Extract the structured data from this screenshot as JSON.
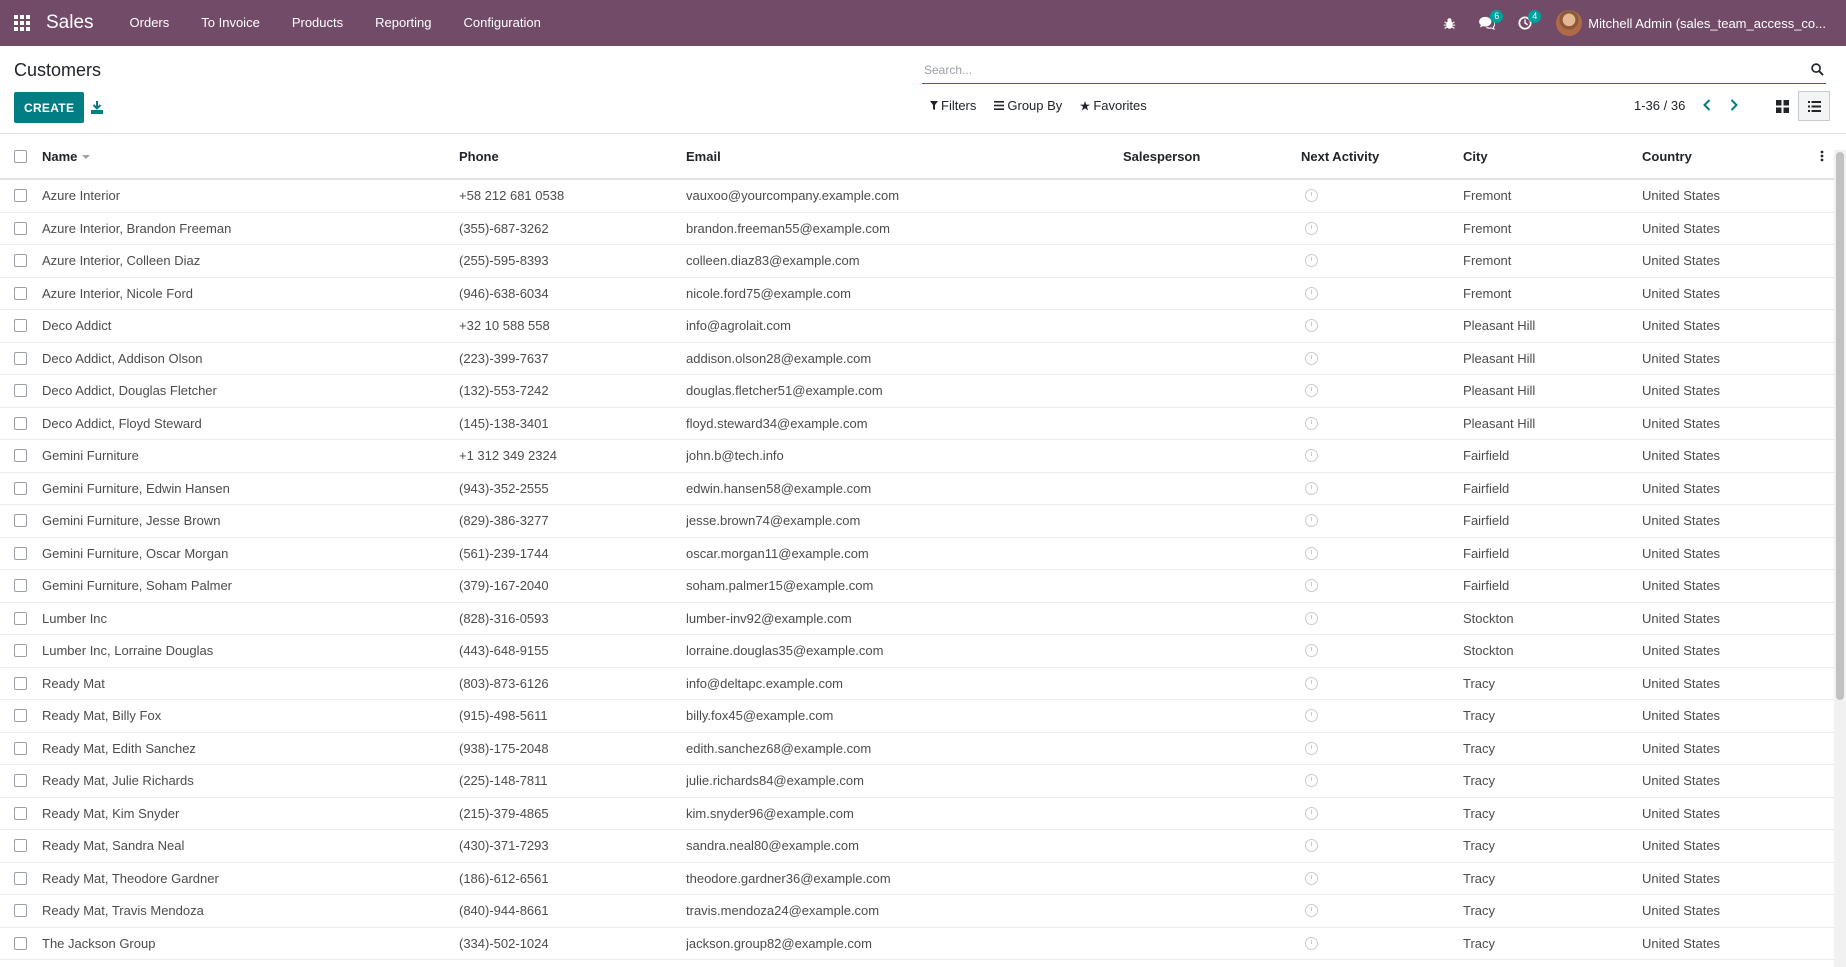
{
  "navbar": {
    "app_name": "Sales",
    "menu": [
      "Orders",
      "To Invoice",
      "Products",
      "Reporting",
      "Configuration"
    ],
    "messages_badge": "6",
    "activities_badge": "4",
    "user_name": "Mitchell Admin (sales_team_access_co..."
  },
  "control": {
    "breadcrumb": "Customers",
    "create_label": "CREATE",
    "search_placeholder": "Search...",
    "filters_label": "Filters",
    "groupby_label": "Group By",
    "favorites_label": "Favorites",
    "pager": "1-36 / 36"
  },
  "table": {
    "headers": {
      "name": "Name",
      "phone": "Phone",
      "email": "Email",
      "salesperson": "Salesperson",
      "next_activity": "Next Activity",
      "city": "City",
      "country": "Country"
    },
    "rows": [
      {
        "name": "Azure Interior",
        "phone": "+58 212 681 0538",
        "email": "vauxoo@yourcompany.example.com",
        "salesperson": "",
        "city": "Fremont",
        "country": "United States"
      },
      {
        "name": "Azure Interior, Brandon Freeman",
        "phone": "(355)-687-3262",
        "email": "brandon.freeman55@example.com",
        "salesperson": "",
        "city": "Fremont",
        "country": "United States"
      },
      {
        "name": "Azure Interior, Colleen Diaz",
        "phone": "(255)-595-8393",
        "email": "colleen.diaz83@example.com",
        "salesperson": "",
        "city": "Fremont",
        "country": "United States"
      },
      {
        "name": "Azure Interior, Nicole Ford",
        "phone": "(946)-638-6034",
        "email": "nicole.ford75@example.com",
        "salesperson": "",
        "city": "Fremont",
        "country": "United States"
      },
      {
        "name": "Deco Addict",
        "phone": "+32 10 588 558",
        "email": "info@agrolait.com",
        "salesperson": "",
        "city": "Pleasant Hill",
        "country": "United States"
      },
      {
        "name": "Deco Addict, Addison Olson",
        "phone": "(223)-399-7637",
        "email": "addison.olson28@example.com",
        "salesperson": "",
        "city": "Pleasant Hill",
        "country": "United States"
      },
      {
        "name": "Deco Addict, Douglas Fletcher",
        "phone": "(132)-553-7242",
        "email": "douglas.fletcher51@example.com",
        "salesperson": "",
        "city": "Pleasant Hill",
        "country": "United States"
      },
      {
        "name": "Deco Addict, Floyd Steward",
        "phone": "(145)-138-3401",
        "email": "floyd.steward34@example.com",
        "salesperson": "",
        "city": "Pleasant Hill",
        "country": "United States"
      },
      {
        "name": "Gemini Furniture",
        "phone": "+1 312 349 2324",
        "email": "john.b@tech.info",
        "salesperson": "",
        "city": "Fairfield",
        "country": "United States"
      },
      {
        "name": "Gemini Furniture, Edwin Hansen",
        "phone": "(943)-352-2555",
        "email": "edwin.hansen58@example.com",
        "salesperson": "",
        "city": "Fairfield",
        "country": "United States"
      },
      {
        "name": "Gemini Furniture, Jesse Brown",
        "phone": "(829)-386-3277",
        "email": "jesse.brown74@example.com",
        "salesperson": "",
        "city": "Fairfield",
        "country": "United States"
      },
      {
        "name": "Gemini Furniture, Oscar Morgan",
        "phone": "(561)-239-1744",
        "email": "oscar.morgan11@example.com",
        "salesperson": "",
        "city": "Fairfield",
        "country": "United States"
      },
      {
        "name": "Gemini Furniture, Soham Palmer",
        "phone": "(379)-167-2040",
        "email": "soham.palmer15@example.com",
        "salesperson": "",
        "city": "Fairfield",
        "country": "United States"
      },
      {
        "name": "Lumber Inc",
        "phone": "(828)-316-0593",
        "email": "lumber-inv92@example.com",
        "salesperson": "",
        "city": "Stockton",
        "country": "United States"
      },
      {
        "name": "Lumber Inc, Lorraine Douglas",
        "phone": "(443)-648-9155",
        "email": "lorraine.douglas35@example.com",
        "salesperson": "",
        "city": "Stockton",
        "country": "United States"
      },
      {
        "name": "Ready Mat",
        "phone": "(803)-873-6126",
        "email": "info@deltapc.example.com",
        "salesperson": "",
        "city": "Tracy",
        "country": "United States"
      },
      {
        "name": "Ready Mat, Billy Fox",
        "phone": "(915)-498-5611",
        "email": "billy.fox45@example.com",
        "salesperson": "",
        "city": "Tracy",
        "country": "United States"
      },
      {
        "name": "Ready Mat, Edith Sanchez",
        "phone": "(938)-175-2048",
        "email": "edith.sanchez68@example.com",
        "salesperson": "",
        "city": "Tracy",
        "country": "United States"
      },
      {
        "name": "Ready Mat, Julie Richards",
        "phone": "(225)-148-7811",
        "email": "julie.richards84@example.com",
        "salesperson": "",
        "city": "Tracy",
        "country": "United States"
      },
      {
        "name": "Ready Mat, Kim Snyder",
        "phone": "(215)-379-4865",
        "email": "kim.snyder96@example.com",
        "salesperson": "",
        "city": "Tracy",
        "country": "United States"
      },
      {
        "name": "Ready Mat, Sandra Neal",
        "phone": "(430)-371-7293",
        "email": "sandra.neal80@example.com",
        "salesperson": "",
        "city": "Tracy",
        "country": "United States"
      },
      {
        "name": "Ready Mat, Theodore Gardner",
        "phone": "(186)-612-6561",
        "email": "theodore.gardner36@example.com",
        "salesperson": "",
        "city": "Tracy",
        "country": "United States"
      },
      {
        "name": "Ready Mat, Travis Mendoza",
        "phone": "(840)-944-8661",
        "email": "travis.mendoza24@example.com",
        "salesperson": "",
        "city": "Tracy",
        "country": "United States"
      },
      {
        "name": "The Jackson Group",
        "phone": "(334)-502-1024",
        "email": "jackson.group82@example.com",
        "salesperson": "",
        "city": "Tracy",
        "country": "United States"
      }
    ]
  },
  "colors": {
    "navbar": "#714b67",
    "primary": "#017e84",
    "badge": "#00a09d"
  }
}
